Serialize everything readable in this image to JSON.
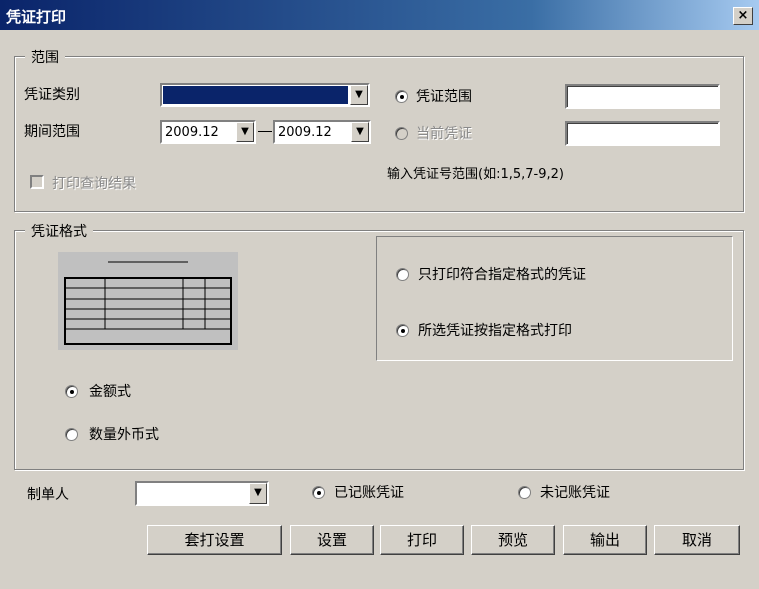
{
  "window": {
    "title": "凭证打印",
    "close": "×"
  },
  "range": {
    "legend": "范围",
    "type_label": "凭证类别",
    "period_label": "期间范围",
    "period_from": "2009.12",
    "period_to": "2009.12",
    "radio_range": "凭证范围",
    "radio_current": "当前凭证",
    "hint": "输入凭证号范围(如:1,5,7-9,2)",
    "print_query": "打印查询结果"
  },
  "format": {
    "legend": "凭证格式",
    "amount_style": "金额式",
    "qty_style": "数量外币式",
    "only_match": "只打印符合指定格式的凭证",
    "all_by_format": "所选凭证按指定格式打印"
  },
  "bottom": {
    "maker_label": "制单人",
    "posted": "已记账凭证",
    "unposted": "未记账凭证"
  },
  "buttons": {
    "template": "套打设置",
    "settings": "设置",
    "print": "打印",
    "preview": "预览",
    "export": "输出",
    "cancel": "取消"
  }
}
